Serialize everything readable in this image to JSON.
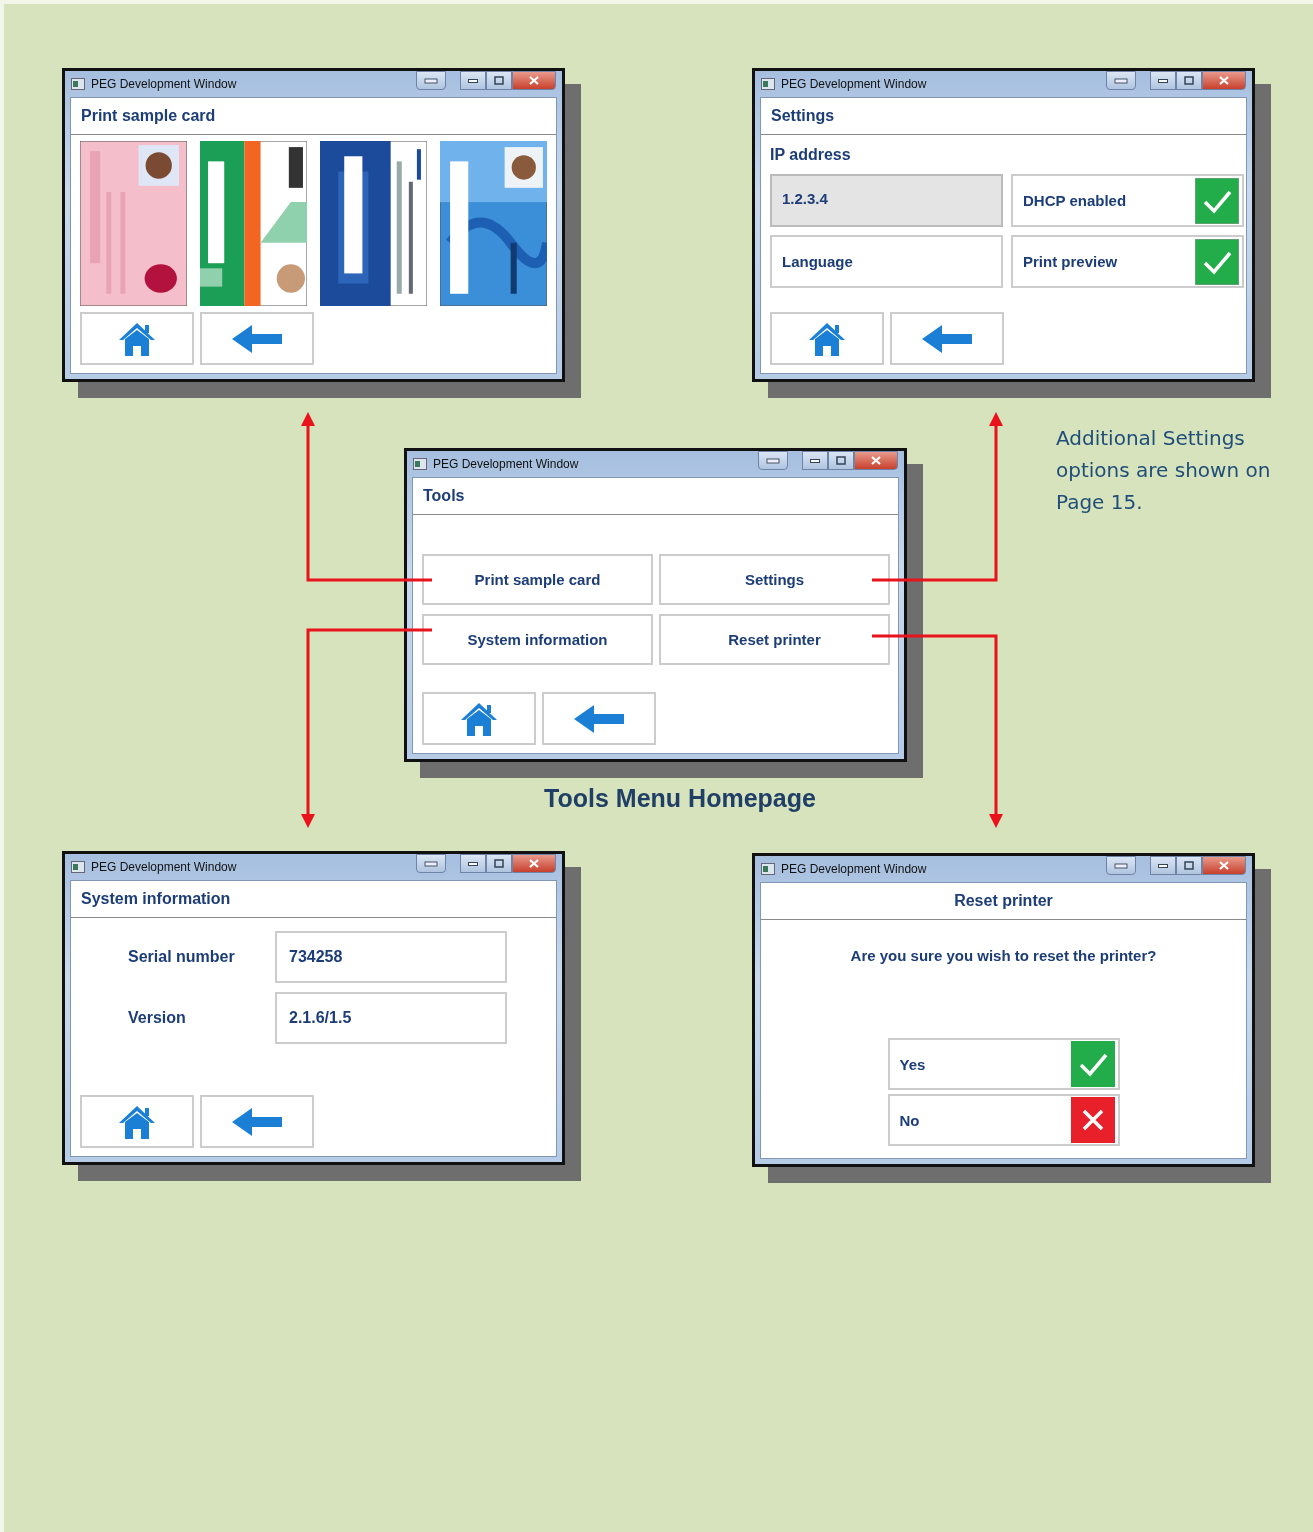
{
  "windows": [
    {
      "kind": "cards",
      "title": "PEG Development Window",
      "heading": "Print sample card"
    },
    {
      "kind": "settings",
      "title": "PEG Development Window",
      "heading": "Settings",
      "section_label": "IP address",
      "items": [
        {
          "kind": "field",
          "value": "1.2.3.4"
        },
        {
          "kind": "toggle",
          "label": "DHCP enabled",
          "checked": true
        },
        {
          "kind": "button",
          "label": "Language"
        },
        {
          "kind": "toggle",
          "label": "Print preview",
          "checked": true
        }
      ]
    },
    {
      "kind": "menu",
      "title": "PEG Development Window",
      "heading": "Tools",
      "buttons": [
        "Print sample card",
        "Settings",
        "System information",
        "Reset printer"
      ]
    },
    {
      "kind": "info",
      "title": "PEG Development Window",
      "heading": "System information",
      "rows": [
        {
          "label": "Serial number",
          "value": "734258"
        },
        {
          "label": "Version",
          "value": "2.1.6/1.5"
        }
      ]
    },
    {
      "kind": "confirm",
      "title": "PEG Development Window",
      "heading": "Reset printer",
      "question": "Are you sure you wish to reset the printer?",
      "options": [
        {
          "kind": "confirm",
          "label": "Yes"
        },
        {
          "kind": "cancel",
          "label": "No"
        }
      ]
    }
  ],
  "note": "Additional Settings options are shown on Page 15.",
  "caption": "Tools Menu Homepage"
}
